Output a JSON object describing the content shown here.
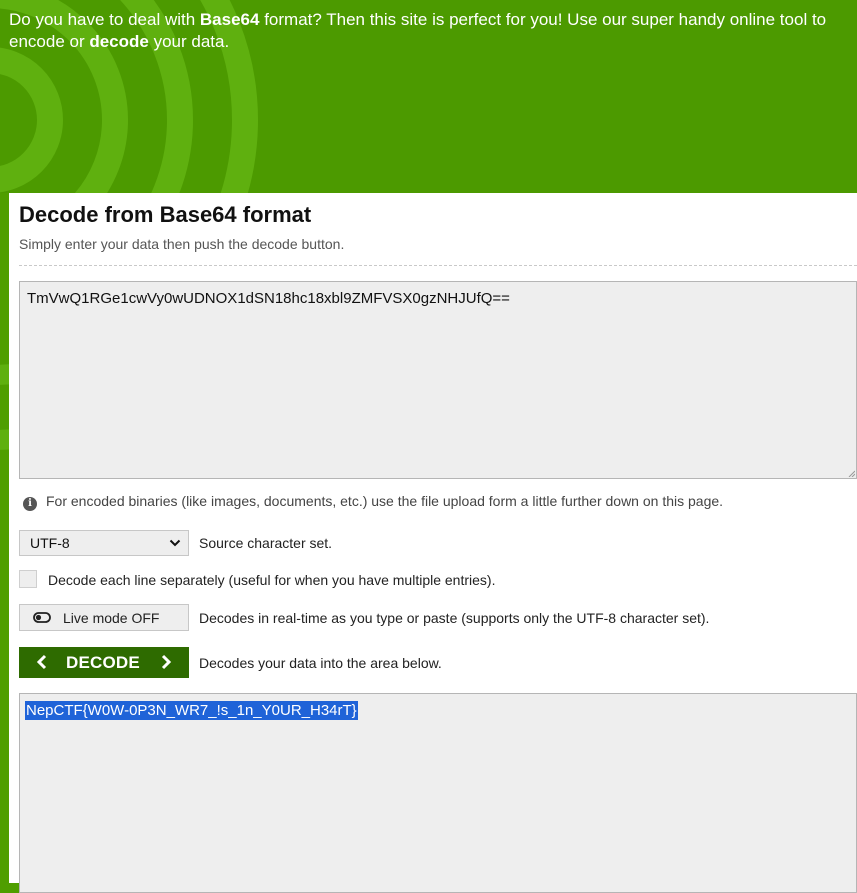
{
  "hero": {
    "line1_a": "Do you have to deal with ",
    "line1_b": "Base64",
    "line1_c": " format? Then this site is perfect for you! Use our super handy online tool to",
    "line2_a": "encode or ",
    "line2_b": "decode",
    "line2_c": " your data."
  },
  "panel": {
    "title": "Decode from Base64 format",
    "subtitle": "Simply enter your data then push the decode button.",
    "input_value": "TmVwQ1RGe1cwVy0wUDNOX1dSN18hc18xbl9ZMFVSX0gzNHJUfQ==",
    "info_text": "For encoded binaries (like images, documents, etc.) use the file upload form a little further down on this page.",
    "charset": {
      "value": "UTF-8",
      "label": "Source character set."
    },
    "line_checkbox_label": "Decode each line separately (useful for when you have multiple entries).",
    "live_mode": {
      "button_label": "Live mode OFF",
      "description": "Decodes in real-time as you type or paste (supports only the UTF-8 character set)."
    },
    "decode": {
      "button_label": "DECODE",
      "description": "Decodes your data into the area below."
    },
    "output_value": "NepCTF{W0W-0P3N_WR7_!s_1n_Y0UR_H34rT}"
  },
  "icons": {
    "info": "info-icon",
    "select_chevron": "chevron-down-icon",
    "toggle": "toggle-icon",
    "left_arrow": "chevron-left-icon",
    "right_arrow": "chevron-right-icon"
  },
  "colors": {
    "brand_green": "#4c9a00",
    "decode_button": "#2e6b00",
    "selection": "#1f63d8"
  }
}
